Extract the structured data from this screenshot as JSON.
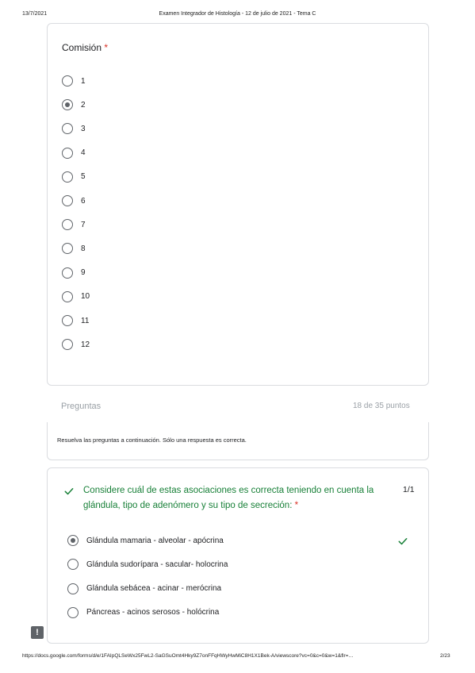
{
  "print_header": {
    "date": "13/7/2021",
    "title": "Examen Integrador de Histología - 12 de julio de 2021 - Tema C"
  },
  "comision": {
    "label": "Comisión",
    "required_mark": "*",
    "options": [
      "1",
      "2",
      "3",
      "4",
      "5",
      "6",
      "7",
      "8",
      "9",
      "10",
      "11",
      "12"
    ],
    "selected": "2"
  },
  "section": {
    "title": "Preguntas",
    "points": "18 de 35 puntos",
    "description": "Resuelva las preguntas a continuación. Sólo una respuesta es correcta."
  },
  "question1": {
    "text": "Considere cuál de estas asociaciones es correcta teniendo en cuenta la glándula, tipo de adenómero y su tipo de secreción:",
    "required_mark": "*",
    "score": "1/1",
    "options": [
      "Glándula mamaria - alveolar - apócrina",
      "Glándula sudorípara - sacular- holocrina",
      "Glándula sebácea - acinar - merócrina",
      "Páncreas - acinos serosos - holócrina"
    ],
    "selected": "Glándula mamaria - alveolar - apócrina",
    "correct_color": "#188038"
  },
  "print_footer": {
    "url": "https://docs.google.com/forms/d/e/1FAIpQLSeWx25FwL2-SaGSuOmt4Hky9Z7onFFqHWyHwMiC8H1X1Bek-A/viewscore?vc=0&c=0&w=1&flr=…",
    "page": "2/23"
  },
  "icons": {
    "correct": "check-icon",
    "feedback": "feedback-icon"
  }
}
